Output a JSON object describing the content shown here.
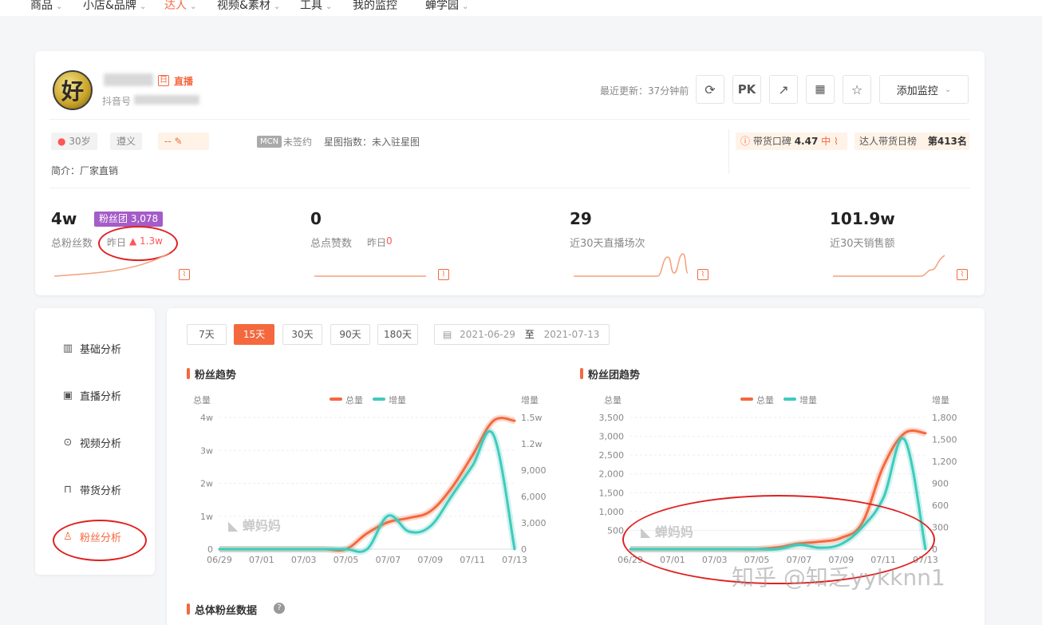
{
  "nav": {
    "items": [
      "商品",
      "小店&品牌",
      "达人",
      "视频&素材",
      "工具",
      "我的监控",
      "蝉学园"
    ],
    "active_index": 2
  },
  "profile": {
    "badge_live": "直播",
    "account_prefix": "抖音号",
    "last_update": "最近更新：37分钟前",
    "pk_label": "PK",
    "monitor_button": "添加监控",
    "tags": {
      "age": "30岁",
      "city": "遵义",
      "edit": "--"
    },
    "mcn_tag": "MCN",
    "mcn_status": "未签约",
    "xingtu": "星图指数：未入驻星图",
    "intro": "简介：厂家直销",
    "reputation_label": "带货口碑",
    "reputation_score": "4.47",
    "reputation_level": "中",
    "rank_label": "达人带货日榜",
    "rank_value": "第413名"
  },
  "stats": [
    {
      "value": "4w",
      "label": "总粉丝数",
      "badge": "粉丝团 3,078",
      "delta_label": "昨日",
      "delta": "▲ 1.3w"
    },
    {
      "value": "0",
      "label": "总点赞数",
      "delta_label": "昨日",
      "delta": "0"
    },
    {
      "value": "29",
      "label": "近30天直播场次"
    },
    {
      "value": "101.9w",
      "label": "近30天销售额"
    }
  ],
  "sidebar": {
    "items": [
      {
        "label": "基础分析",
        "icon": "bar-chart-icon"
      },
      {
        "label": "直播分析",
        "icon": "live-icon"
      },
      {
        "label": "视频分析",
        "icon": "play-icon"
      },
      {
        "label": "带货分析",
        "icon": "bag-icon"
      },
      {
        "label": "粉丝分析",
        "icon": "user-icon"
      }
    ],
    "active_index": 4
  },
  "range": {
    "options": [
      "7天",
      "15天",
      "30天",
      "90天",
      "180天"
    ],
    "active_index": 1,
    "date_from": "2021-06-29",
    "date_sep": "至",
    "date_to": "2021-07-13"
  },
  "sections": {
    "fans_trend": "粉丝趋势",
    "fan_group_trend": "粉丝团趋势",
    "total_fans": "总体粉丝数据"
  },
  "watermark": "知乎 @知乏yykknn1",
  "logo_text": "蝉妈妈",
  "colors": {
    "accent": "#f5683d",
    "total": "#f5683d",
    "increase": "#3ecbbd"
  },
  "chart_data": [
    {
      "type": "line",
      "title": "粉丝趋势",
      "ylabel": "总量",
      "y2label": "增量",
      "legend": [
        "总量",
        "增量"
      ],
      "legend_position": "top-center",
      "x": [
        "06/29",
        "06/30",
        "07/01",
        "07/02",
        "07/03",
        "07/04",
        "07/05",
        "07/06",
        "07/07",
        "07/08",
        "07/09",
        "07/10",
        "07/11",
        "07/12",
        "07/13"
      ],
      "x_ticks": [
        "06/29",
        "07/01",
        "07/03",
        "07/05",
        "07/07",
        "07/09",
        "07/11",
        "07/13"
      ],
      "y_ticks": [
        "0",
        "1w",
        "2w",
        "3w",
        "4w"
      ],
      "y2_ticks": [
        "0",
        "3,000",
        "6,000",
        "9,000",
        "1.2w",
        "1.5w"
      ],
      "ylim": [
        0,
        40000
      ],
      "y2lim": [
        0,
        15000
      ],
      "series": [
        {
          "name": "总量",
          "axis": "left",
          "values": [
            0,
            0,
            0,
            0,
            0,
            0,
            0,
            4800,
            8200,
            9500,
            11500,
            18500,
            28500,
            39000,
            39000
          ]
        },
        {
          "name": "增量",
          "axis": "right",
          "values": [
            0,
            0,
            0,
            0,
            0,
            0,
            0,
            0,
            3800,
            2000,
            2600,
            6000,
            9500,
            13000,
            0
          ]
        }
      ]
    },
    {
      "type": "line",
      "title": "粉丝团趋势",
      "ylabel": "总量",
      "y2label": "增量",
      "legend": [
        "总量",
        "增量"
      ],
      "legend_position": "top-center",
      "x": [
        "06/29",
        "06/30",
        "07/01",
        "07/02",
        "07/03",
        "07/04",
        "07/05",
        "07/06",
        "07/07",
        "07/08",
        "07/09",
        "07/10",
        "07/11",
        "07/12",
        "07/13"
      ],
      "x_ticks": [
        "06/29",
        "07/01",
        "07/03",
        "07/05",
        "07/07",
        "07/09",
        "07/11",
        "07/13"
      ],
      "y_ticks": [
        "500",
        "1,000",
        "1,500",
        "2,000",
        "2,500",
        "3,000",
        "3,500"
      ],
      "y2_ticks": [
        "0",
        "300",
        "600",
        "900",
        "1,200",
        "1,500",
        "1,800"
      ],
      "ylim": [
        0,
        3500
      ],
      "y2lim": [
        0,
        1800
      ],
      "series": [
        {
          "name": "总量",
          "axis": "left",
          "values": [
            0,
            0,
            0,
            0,
            0,
            0,
            0,
            50,
            150,
            200,
            300,
            700,
            2200,
            3080,
            3080
          ]
        },
        {
          "name": "增量",
          "axis": "right",
          "values": [
            0,
            0,
            0,
            0,
            0,
            0,
            0,
            0,
            60,
            20,
            70,
            300,
            700,
            1500,
            0
          ]
        }
      ]
    }
  ]
}
